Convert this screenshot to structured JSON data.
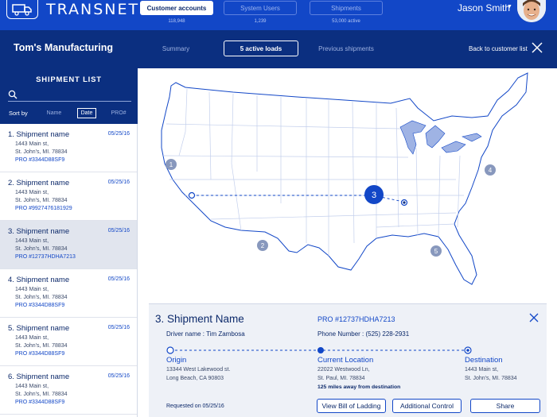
{
  "app": {
    "brand": "TRANSNET",
    "nav_tabs": [
      {
        "label": "Customer accounts",
        "count": "118,948",
        "active": true
      },
      {
        "label": "System Users",
        "count": "1,239",
        "active": false
      },
      {
        "label": "Shipments",
        "count": "53,000 active",
        "active": false
      }
    ],
    "user": {
      "name": "Jason Smith"
    }
  },
  "subheader": {
    "company": "Tom's Manufacturing",
    "tabs": [
      {
        "label": "Summary",
        "active": false
      },
      {
        "label": "5 active loads",
        "active": true
      },
      {
        "label": "Previous shipments",
        "active": false
      }
    ],
    "back_label": "Back to customer list"
  },
  "sidebar": {
    "title": "SHIPMENT LIST",
    "sort_label": "Sort by",
    "sort_options": [
      {
        "label": "Name",
        "active": false
      },
      {
        "label": "Date",
        "active": true
      },
      {
        "label": "PRO#",
        "active": false
      }
    ],
    "items": [
      {
        "title": "1. Shipment name",
        "date": "05/25/16",
        "line1": "1443 Main st,",
        "line2": "St. John's, MI. 78834",
        "pro": "PRO #3344D88SF9",
        "selected": false
      },
      {
        "title": "2. Shipment name",
        "date": "05/25/16",
        "line1": "1443 Main st,",
        "line2": "St. John's, MI. 78834",
        "pro": "PRO #9927476181929",
        "selected": false
      },
      {
        "title": "3. Shipment name",
        "date": "05/25/16",
        "line1": "1443 Main st,",
        "line2": "St. John's, MI. 78834",
        "pro": "PRO #12737HDHA7213",
        "selected": true
      },
      {
        "title": "4. Shipment name",
        "date": "05/25/16",
        "line1": "1443 Main st,",
        "line2": "St. John's, MI. 78834",
        "pro": "PRO #3344D88SF9",
        "selected": false
      },
      {
        "title": "5. Shipment name",
        "date": "05/25/16",
        "line1": "1443 Main st,",
        "line2": "St. John's, MI. 78834",
        "pro": "PRO #3344D88SF9",
        "selected": false
      },
      {
        "title": "6. Shipment name",
        "date": "05/25/16",
        "line1": "1443 Main st,",
        "line2": "St. John's, MI. 78834",
        "pro": "PRO #3344D88SF9",
        "selected": false
      }
    ]
  },
  "map": {
    "markers": [
      "1",
      "2",
      "3",
      "4",
      "5"
    ],
    "active_marker": "3"
  },
  "detail": {
    "title": "3. Shipment Name",
    "driver": "Driver name : Tim Zambosa",
    "pro": "PRO #12737HDHA7213",
    "phone": "Phone Number : (525) 228-2931",
    "origin": {
      "label": "Origin",
      "line1": "13344 West Lakewood st.",
      "line2": "Long Beach, CA 90803"
    },
    "current": {
      "label": "Current Location",
      "line1": "22022 Westwood Ln,",
      "line2": "St. Paul, MI. 78834",
      "note": "125 miles away from destination"
    },
    "destination": {
      "label": "Destination",
      "line1": "1443 Main st,",
      "line2": "St. John's, MI. 78834"
    },
    "requested": "Requested on 05/25/16",
    "buttons": {
      "bill": "View Bill of Ladding",
      "control": "Additional Control",
      "share": "Share"
    }
  },
  "colors": {
    "primary": "#1247c7",
    "navy": "#0b2f80",
    "panel": "#eef1f7"
  }
}
